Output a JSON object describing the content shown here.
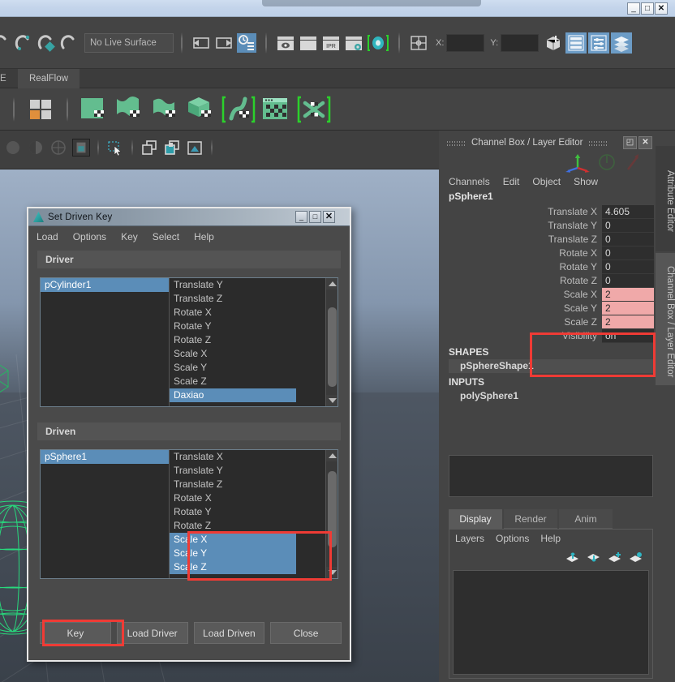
{
  "window": {
    "controls": {
      "minimize": "_",
      "maximize": "□",
      "close": "✕"
    }
  },
  "toolbar": {
    "live_surface_field": "No Live Surface",
    "coord_x_label": "X:",
    "coord_y_label": "Y:",
    "coord_x_value": "",
    "coord_y_value": "",
    "icons": [
      "snap-to-curve-icon",
      "snap-to-point-icon",
      "snap-to-projected-center-icon",
      "snap-to-view-plane-icon",
      "make-live-icon",
      "input-line-left-icon",
      "input-line-right-icon",
      "construction-history-icon",
      "render-current-frame-icon",
      "render-sequence-icon",
      "ipr-render-icon",
      "render-settings-icon",
      "hypershade-icon",
      "viewport-layout-icon",
      "mesh-display-icon",
      "show-attribute-editor-icon",
      "show-tool-settings-icon",
      "show-channel-box-icon"
    ]
  },
  "shelf": {
    "tabs": [
      {
        "label": "E",
        "selected": false
      },
      {
        "label": "RealFlow",
        "selected": true
      }
    ],
    "icons": [
      "shelf-layout-icon",
      "realflow-plane-icon",
      "realflow-mesh-icon",
      "realflow-cloth-icon",
      "realflow-volume-icon",
      "realflow-curve-icon",
      "realflow-window-icon",
      "realflow-connect-icon"
    ]
  },
  "viewport_toolstrip": {
    "icons": [
      "shaded-sphere-icon",
      "half-shaded-sphere-icon",
      "wireframe-sphere-icon",
      "texture-mode-icon",
      "select-tool-icon",
      "two-panel-icon",
      "two-panel-shaded-icon",
      "image-plane-icon"
    ]
  },
  "set_driven_key": {
    "title": "Set Driven Key",
    "window_controls": {
      "minimize": "_",
      "maximize": "□",
      "close": "✕"
    },
    "menus": [
      "Load",
      "Options",
      "Key",
      "Select",
      "Help"
    ],
    "driver": {
      "header": "Driver",
      "objects": [
        {
          "label": "pCylinder1",
          "selected": true
        }
      ],
      "attributes": [
        {
          "label": "Translate Y",
          "selected": false
        },
        {
          "label": "Translate Z",
          "selected": false
        },
        {
          "label": "Rotate X",
          "selected": false
        },
        {
          "label": "Rotate Y",
          "selected": false
        },
        {
          "label": "Rotate Z",
          "selected": false
        },
        {
          "label": "Scale X",
          "selected": false
        },
        {
          "label": "Scale Y",
          "selected": false
        },
        {
          "label": "Scale Z",
          "selected": false
        },
        {
          "label": "Daxiao",
          "selected": true
        }
      ]
    },
    "driven": {
      "header": "Driven",
      "objects": [
        {
          "label": "pSphere1",
          "selected": true
        }
      ],
      "attributes": [
        {
          "label": "Translate X",
          "selected": false
        },
        {
          "label": "Translate Y",
          "selected": false
        },
        {
          "label": "Translate Z",
          "selected": false
        },
        {
          "label": "Rotate X",
          "selected": false
        },
        {
          "label": "Rotate Y",
          "selected": false
        },
        {
          "label": "Rotate Z",
          "selected": false
        },
        {
          "label": "Scale X",
          "selected": true
        },
        {
          "label": "Scale Y",
          "selected": true
        },
        {
          "label": "Scale Z",
          "selected": true
        }
      ]
    },
    "buttons": [
      {
        "label": "Key",
        "highlighted": true
      },
      {
        "label": "Load Driver",
        "highlighted": false
      },
      {
        "label": "Load Driven",
        "highlighted": false
      },
      {
        "label": "Close",
        "highlighted": false
      }
    ]
  },
  "channel_box": {
    "title": "Channel Box / Layer Editor",
    "window_controls": {
      "float": "◰",
      "close": "✕"
    },
    "menus": [
      "Channels",
      "Edit",
      "Object",
      "Show"
    ],
    "object_name": "pSphere1",
    "attributes": [
      {
        "label": "Translate X",
        "value": "4.605",
        "highlighted": false
      },
      {
        "label": "Translate Y",
        "value": "0",
        "highlighted": false
      },
      {
        "label": "Translate Z",
        "value": "0",
        "highlighted": false
      },
      {
        "label": "Rotate X",
        "value": "0",
        "highlighted": false
      },
      {
        "label": "Rotate Y",
        "value": "0",
        "highlighted": false
      },
      {
        "label": "Rotate Z",
        "value": "0",
        "highlighted": false
      },
      {
        "label": "Scale X",
        "value": "2",
        "highlighted": true
      },
      {
        "label": "Scale Y",
        "value": "2",
        "highlighted": true
      },
      {
        "label": "Scale Z",
        "value": "2",
        "highlighted": true
      },
      {
        "label": "Visibility",
        "value": "on",
        "highlighted": false
      }
    ],
    "shapes_header": "SHAPES",
    "shape_node": "pSphereShape1",
    "inputs_header": "INPUTS",
    "input_node": "polySphere1",
    "layer_tabs": [
      {
        "label": "Display",
        "selected": true
      },
      {
        "label": "Render",
        "selected": false
      },
      {
        "label": "Anim",
        "selected": false
      }
    ],
    "layer_menus": [
      "Layers",
      "Options",
      "Help"
    ],
    "layer_icons": [
      "move-layer-up-icon",
      "move-layer-down-icon",
      "new-layer-icon",
      "new-layer-from-selected-icon"
    ]
  },
  "side_tabs": [
    {
      "label": "Attribute Editor",
      "selected": false
    },
    {
      "label": "Channel Box / Layer Editor",
      "selected": true
    }
  ],
  "colors": {
    "accent_blue": "#5b8db8",
    "highlight_red": "#ef3b35",
    "pink_field": "#f0a9a9",
    "shelf_green": "#63bd8f",
    "panel_bg": "#444444"
  }
}
